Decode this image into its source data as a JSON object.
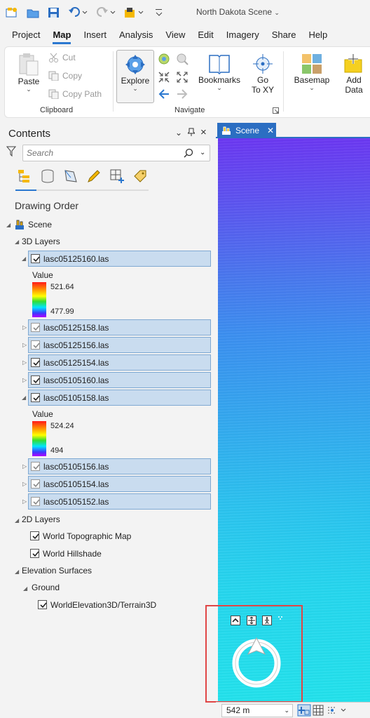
{
  "app": {
    "title": "North Dakota Scene"
  },
  "menu_tabs": [
    "Project",
    "Map",
    "Insert",
    "Analysis",
    "View",
    "Edit",
    "Imagery",
    "Share",
    "Help"
  ],
  "ribbon": {
    "clipboard": {
      "paste": "Paste",
      "cut": "Cut",
      "copy": "Copy",
      "copy_path": "Copy Path",
      "group_label": "Clipboard"
    },
    "navigate": {
      "explore": "Explore",
      "bookmarks": "Bookmarks",
      "go_to_xy_line1": "Go",
      "go_to_xy_line2": "To XY",
      "group_label": "Navigate"
    },
    "layer": {
      "basemap": "Basemap",
      "add_data_line1": "Add",
      "add_data_line2": "Data"
    }
  },
  "contents": {
    "title": "Contents",
    "search_placeholder": "Search",
    "drawing_order": "Drawing Order",
    "scene_label": "Scene",
    "layers_3d_label": "3D Layers",
    "layers_3d": [
      {
        "name": "lasc05125160.las",
        "checked": true,
        "expanded": true,
        "legend": {
          "title": "Value",
          "max": "521.64",
          "min": "477.99"
        }
      },
      {
        "name": "lasc05125158.las",
        "checked": true,
        "expanded": false
      },
      {
        "name": "lasc05125156.las",
        "checked": true,
        "expanded": false
      },
      {
        "name": "lasc05125154.las",
        "checked": true,
        "expanded": false
      },
      {
        "name": "lasc05105160.las",
        "checked": true,
        "expanded": false
      },
      {
        "name": "lasc05105158.las",
        "checked": true,
        "expanded": true,
        "legend": {
          "title": "Value",
          "max": "524.24",
          "min": "494"
        }
      },
      {
        "name": "lasc05105156.las",
        "checked": true,
        "expanded": false
      },
      {
        "name": "lasc05105154.las",
        "checked": true,
        "expanded": false
      },
      {
        "name": "lasc05105152.las",
        "checked": true,
        "expanded": false
      }
    ],
    "layers_2d_label": "2D Layers",
    "layers_2d": [
      "World Topographic Map",
      "World Hillshade"
    ],
    "elevation_label": "Elevation Surfaces",
    "ground_label": "Ground",
    "ground_surface": "WorldElevation3D/Terrain3D"
  },
  "scene_view": {
    "tab_label": "Scene"
  },
  "status_bar": {
    "scale": "542 m"
  },
  "colors": {
    "accent": "#2b78d0",
    "selection": "#c9dcef",
    "highlight_box": "#e04646"
  }
}
